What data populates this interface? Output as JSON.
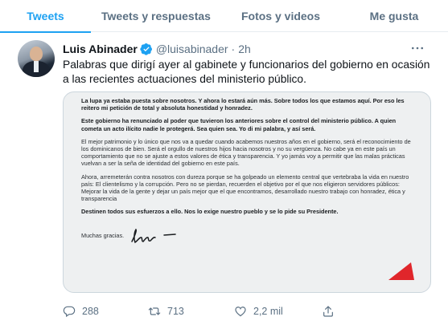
{
  "tabs": [
    {
      "label": "Tweets",
      "active": true
    },
    {
      "label": "Tweets y respuestas",
      "active": false
    },
    {
      "label": "Fotos y videos",
      "active": false
    },
    {
      "label": "Me gusta",
      "active": false
    }
  ],
  "tweet": {
    "author": {
      "name": "Luis Abinader",
      "handle": "@luisabinader",
      "verified": true
    },
    "separator": "·",
    "time": "2h",
    "more_icon": "more-dots-icon",
    "text": "Palabras que dirigí ayer al gabinete y funcionarios del gobierno en ocasión a las recientes actuaciones del ministerio público.",
    "image": {
      "paragraphs": [
        {
          "bold": true,
          "text": "La lupa ya estaba puesta sobre nosotros. Y ahora lo estará aún más. Sobre todos los que estamos aquí. Por eso les reitero mi petición de total y absoluta honestidad y honradez."
        },
        {
          "bold": true,
          "text": "Este gobierno ha renunciado al poder que tuvieron los anteriores sobre el control del ministerio público. A quien cometa un acto ilícito nadie le protegerá. Sea quien sea. Yo di mi palabra, y así será."
        },
        {
          "bold": false,
          "text": "El mejor patrimonio y lo único que nos va a quedar cuando acabemos nuestros años en el gobierno, será el reconocimiento de los dominicanos de bien. Será el orgullo de nuestros hijos hacia nosotros y no su vergüenza. No cabe ya en este país un comportamiento que no se ajuste a estos valores de ética y transparencia. Y yo jamás voy a permitir que las malas prácticas vuelvan a ser la seña de identidad del gobierno en este país."
        },
        {
          "bold": false,
          "text": "Ahora, arremeterán contra nosotros con dureza porque se ha golpeado un elemento central que vertebraba la vida en nuestro país: El clientelismo y la corrupción. Pero no se pierdan, recuerden el objetivo por el que nos eligieron servidores públicos: Mejorar la vida de la gente y dejar un país mejor que el que encontramos, desarrollado nuestro trabajo con honradez, ética y transparencia"
        }
      ],
      "final": "Destinen todos sus esfuerzos a ello. Nos lo exige nuestro pueblo y se lo pide su Presidente.",
      "closing": "Muchas gracias."
    },
    "actions": {
      "reply": {
        "icon": "reply-icon",
        "count": "288"
      },
      "retweet": {
        "icon": "retweet-icon",
        "count": "713"
      },
      "like": {
        "icon": "heart-icon",
        "count": "2,2 mil"
      },
      "share": {
        "icon": "share-icon"
      }
    }
  },
  "colors": {
    "accent": "#1da1f2",
    "secondary_text": "#5b7083",
    "border": "#e6ecf0",
    "letter_mark": "#e0262b"
  }
}
